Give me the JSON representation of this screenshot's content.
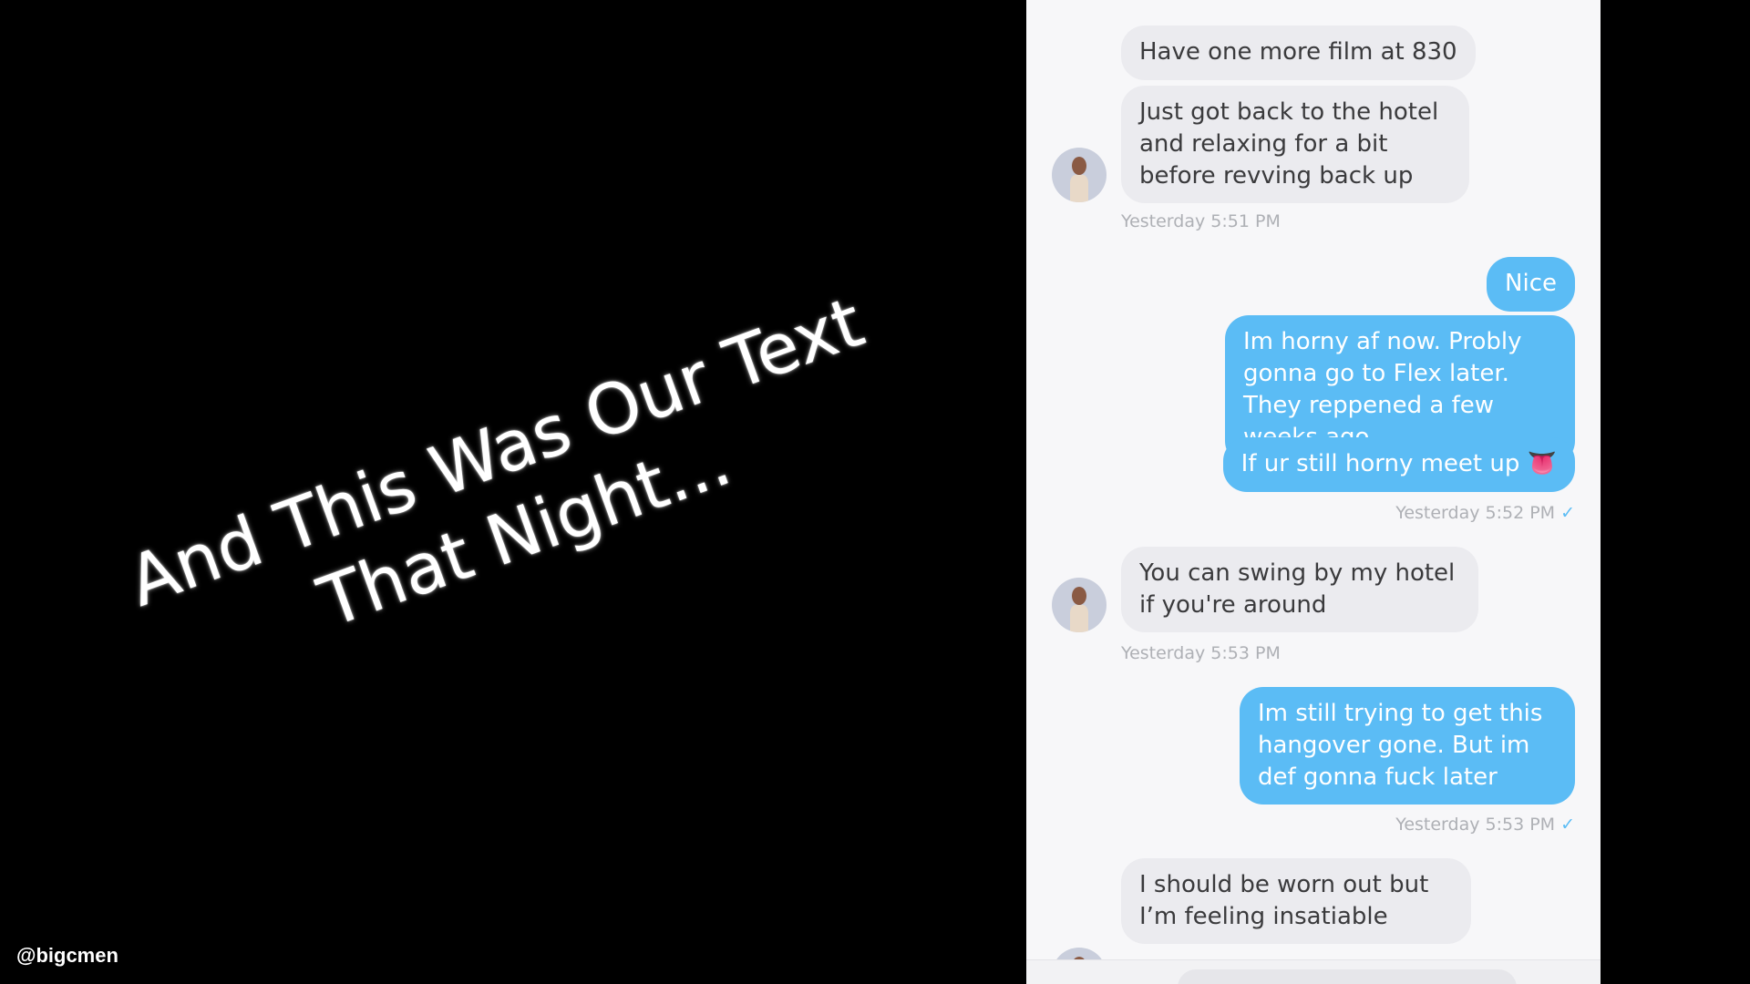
{
  "caption": {
    "line1": "And This Was Our Text",
    "line2": "That Night..."
  },
  "watermark": "@bigcmen",
  "chat": {
    "messages": [
      {
        "from": "them",
        "text": "Have one more film at 830"
      },
      {
        "from": "them",
        "text": "Just got back to the hotel and relaxing for a bit before revving back up"
      },
      {
        "type": "timestamp",
        "text": "Yesterday 5:51 PM"
      },
      {
        "from": "me",
        "text": "Nice"
      },
      {
        "from": "me",
        "text": "Im horny af now. Probly gonna go to Flex later. They reppened a few weeks ago."
      },
      {
        "from": "me",
        "text": "If ur still horny meet up 👅"
      },
      {
        "type": "timestamp",
        "text": "Yesterday 5:52 PM",
        "read_mark": "✓"
      },
      {
        "from": "them",
        "text": "You can swing by my hotel if you're around"
      },
      {
        "type": "timestamp",
        "text": "Yesterday 5:53 PM"
      },
      {
        "from": "me",
        "text": "Im still trying to get this hangover gone. But im def gonna fuck later"
      },
      {
        "type": "timestamp",
        "text": "Yesterday 5:53 PM",
        "read_mark": "✓"
      },
      {
        "from": "them",
        "text": "I should be worn out but I’m feeling insatiable"
      }
    ]
  },
  "colors": {
    "outgoing_bubble": "#5bbcf5",
    "incoming_bubble": "#ebebef",
    "panel_bg": "#f7f7f9"
  }
}
